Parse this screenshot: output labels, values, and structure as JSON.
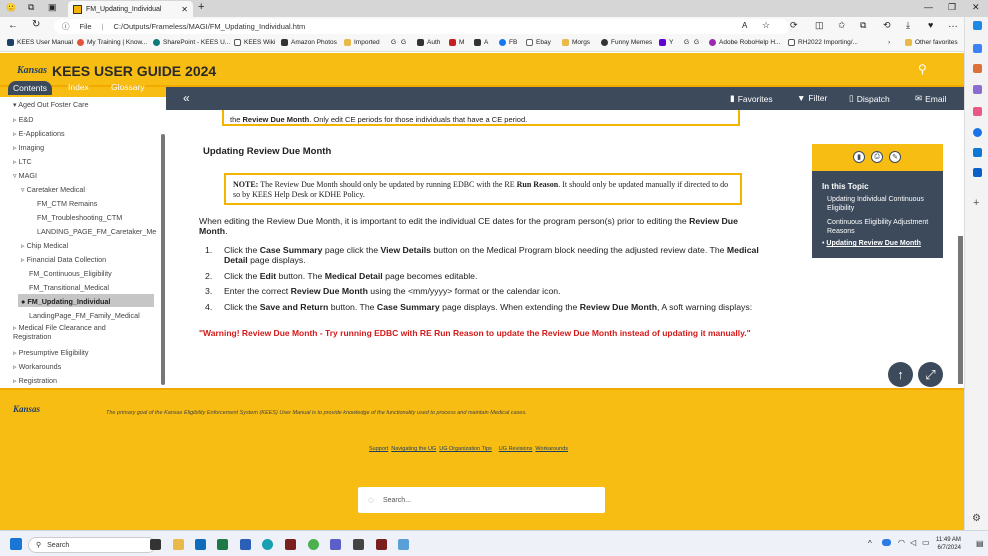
{
  "browser": {
    "tab_title": "FM_Updating_Individual",
    "file_label": "File",
    "url": "C:/Outputs/Frameless/MAGI/FM_Updating_Individual.htm",
    "favorites": [
      "KEES User Manual",
      "My Training | Know...",
      "SharePoint - KEES U...",
      "KEES Wiki",
      "Amazon Photos",
      "Imported",
      "G",
      "G",
      "Auth",
      "M",
      "M",
      "A",
      "A",
      "FB",
      "Ebay",
      "Morgs",
      "Funny Memes",
      "Y",
      "G",
      "G",
      "Adobe RoboHelp H...",
      "RH2022 Importing/...",
      "Other favorites"
    ]
  },
  "header": {
    "logo": "Kansas",
    "title": "KEES USER GUIDE 2024"
  },
  "tabs": [
    "Contents",
    "Index",
    "Glossary"
  ],
  "toolbar": {
    "favorites": "Favorites",
    "filter": "Filter",
    "dispatch": "Dispatch",
    "email": "Email"
  },
  "toc": [
    "Aged Out Foster Care",
    "E&D",
    "E-Applications",
    "Imaging",
    "LTC",
    "MAGI",
    "Caretaker Medical",
    "FM_CTM Remains",
    "FM_Troubleshooting_CTM",
    "LANDING_PAGE_FM_Caretaker_Me",
    "Chip Medical",
    "Financial Data Collection",
    "FM_Continuous_Eligibility",
    "FM_Transitional_Medical",
    "FM_Updating_Individual",
    "LandingPage_FM_Family_Medical",
    "Medical File Clearance and Registration",
    "Presumptive Eligibility",
    "Workarounds",
    "Registration"
  ],
  "content": {
    "top_note_start": "the ",
    "top_note_bold": "Review Due Month",
    "top_note_end": ". Only edit CE periods for those individuals that have a CE period.",
    "heading": "Updating Review Due Month",
    "note_label": "NOTE:",
    "note_a": " The Review Due Month should only be updated by running EDBC with the RE ",
    "note_bold": "Run Reason",
    "note_b": ". It should only be updated manually if directed to do so by KEES Help Desk or KDHE Policy.",
    "intro_a": "When editing the Review Due Month, it is important to edit the individual CE dates for the program person(s) prior to editing the ",
    "intro_bold": "Review Due Month",
    "intro_end": ".",
    "steps": [
      {
        "num": "1.",
        "parts": [
          "Click the ",
          "Case Summary",
          " page click the ",
          "View Details",
          " button on the Medical Program block needing the adjusted review date. The ",
          "Medical Detail",
          " page displays."
        ]
      },
      {
        "num": "2.",
        "parts": [
          "Click the ",
          "Edit",
          " button. The ",
          "Medical Detail",
          " page becomes editable."
        ]
      },
      {
        "num": "3.",
        "parts": [
          "Enter the correct ",
          "Review Due Month",
          " using the <mm/yyyy> format or the calendar icon."
        ]
      },
      {
        "num": "4.",
        "parts": [
          "Click the ",
          "Save and Return",
          " button. The ",
          "Case Summary",
          " page displays. When extending the ",
          "Review Due Month",
          ", A soft warning displays:"
        ]
      }
    ],
    "warning": "\"Warning! Review Due Month - Try running EDBC with RE Run Reason to update the Review Due Month instead of updating it manually.\""
  },
  "topic": {
    "title": "In this Topic",
    "links": [
      "Updating Individual Continuous Eligibility",
      "Continuous Eligibility Adjustment Reasons",
      "Updating Review Due Month"
    ]
  },
  "footer": {
    "logo": "Kansas",
    "tagline": "The primary goal of the Kansas Eligibility Enforcement System (KEES) User Manual is to provide knowledge of the functionality used to process and maintain Medical cases.",
    "links": [
      "Support",
      "Navigating the UG",
      "UG Organization Tips",
      "UG Revisions",
      "Workarounds"
    ],
    "search_placeholder": "Search..."
  },
  "taskbar": {
    "search": "Search",
    "time": "11:49 AM",
    "date": "6/7/2024"
  },
  "colors": {
    "brand_yellow": "#f8bd12",
    "slate": "#3c4a5c",
    "warning_red": "#d41a1a"
  }
}
